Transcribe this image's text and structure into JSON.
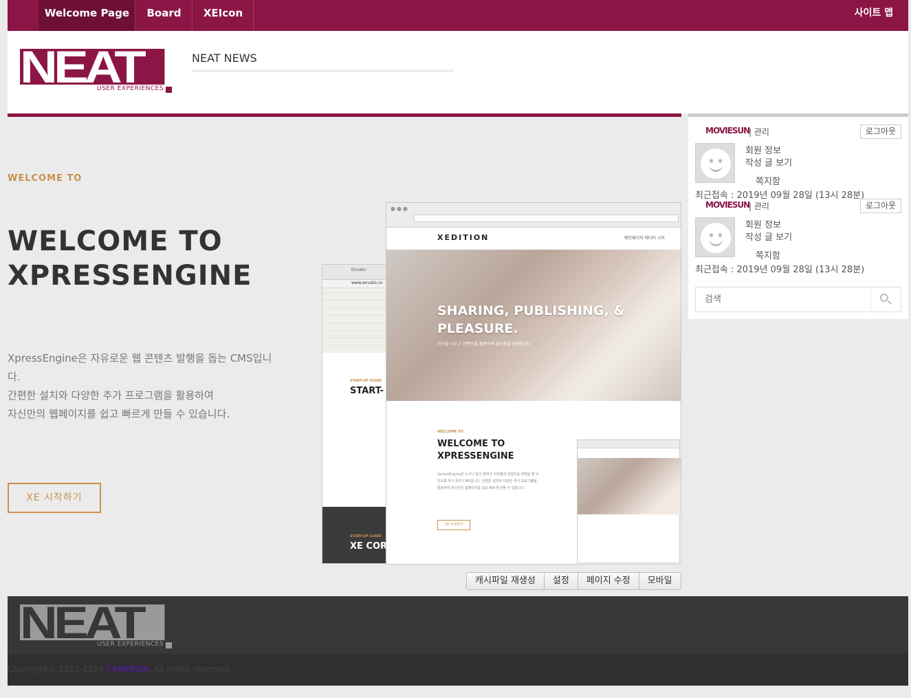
{
  "nav": {
    "items": [
      {
        "label": "Welcome Page",
        "active": true
      },
      {
        "label": "Board",
        "active": false
      },
      {
        "label": "XEIcon",
        "active": false
      }
    ],
    "sitemap": "사이트 맵"
  },
  "header": {
    "logo_text": "NEAT",
    "logo_tagline": "USER EXPERIENCES",
    "news_title": "NEAT NEWS"
  },
  "hero": {
    "kicker": "WELCOME TO",
    "title": "WELCOME TO XPRESSENGINE",
    "description_lines": [
      "XpressEngine은 자유로운 웹 콘텐츠 발행을 돕는 CMS입니다.",
      "간편한 설치와 다양한 추가 프로그램을 활용하여",
      "자신만의 웹페이지를 쉽고 빠르게 만들 수 있습니다."
    ],
    "button": "XE 시작하기"
  },
  "mockup": {
    "brand": "XEDITION",
    "menu": "메인페이지   에디터  시작",
    "slide_title": "SHARING, PUBLISHING, & PLEASURE.",
    "slide_sub": "지식을 나누고 컨텐츠를 출판하며 즐거움을 함께합니다",
    "welcome_kicker": "WELCOME TO",
    "welcome_title": "WELCOME TO XPRESSENGINE",
    "welcome_text": "XpressEngine은 누구나 쉽고 편하고 자유롭게 콘텐츠를 발행을 할 수 있도록 하기 위한 CMS입니다. 간편한 설치와 다양한 추가 프로그램을 활용하여 자신만의 웹페이지를 쉽고 빠르게 만들 수 있습니다.",
    "welcome_button": "XE 시작하기",
    "back_tab": "Envato",
    "back_url": "www.envato.co",
    "back_guide": "START-UP GUIDE",
    "back_title": "START-",
    "back_dark_guide": "START-UP GUIDE",
    "back_dark_title": "XE COR"
  },
  "admin": {
    "buttons": [
      "캐시파일 재생성",
      "설정",
      "페이지 수정",
      "모바일"
    ]
  },
  "sidebar": {
    "users": [
      {
        "name": "MOVIESUN",
        "admin": "| 관리",
        "logout": "로그아웃",
        "member_info": "회원 정보",
        "posts": "작성 글 보기",
        "messages": "쪽지함",
        "last_login": "최근접속 : 2019년 09월 28일 (13시 28분)"
      },
      {
        "name": "MOVIESUN",
        "admin": "| 관리",
        "logout": "로그아웃",
        "member_info": "회원 정보",
        "posts": "작성 글 보기",
        "messages": "쪽지함",
        "last_login": "최근접속 : 2019년 09월 28일 (13시 28분)"
      }
    ],
    "search_placeholder": "검색"
  },
  "footer": {
    "logo_text": "NEAT",
    "logo_tagline": "USER EXPERIENCES",
    "copyright_prefix": "Copyright© 2011-2019 ",
    "copyright_brand": "CAMERON",
    "copyright_suffix": ". All rights reserved."
  },
  "colors": {
    "brand": "#8b1645",
    "accent": "#c8914b",
    "footer": "#373737"
  }
}
